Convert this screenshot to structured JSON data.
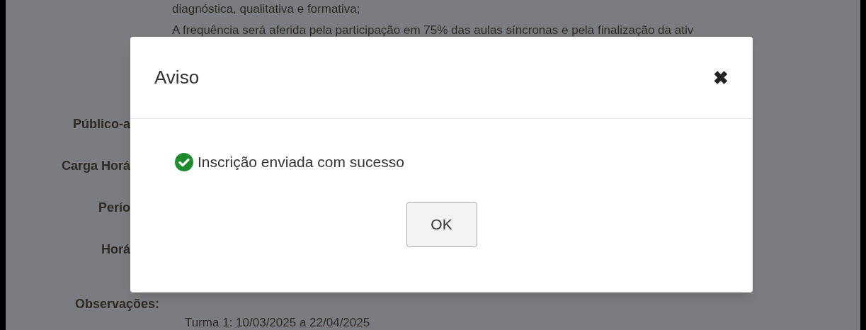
{
  "page": {
    "description_lines": [
      "diagnóstica, qualitativa e formativa;",
      "A frequência será aferida pela participação em 75% das aulas síncronas e pela finalização da ativ"
    ],
    "field_labels": [
      "Público-a",
      "Carga Horá",
      "Perío",
      "Horá"
    ],
    "observations_label": "Observações:",
    "bottom_value": "Turma 1: 10/03/2025 a 22/04/2025"
  },
  "dialog": {
    "title": "Aviso",
    "close": "✖",
    "message": "Inscrição enviada com sucesso",
    "success": true,
    "button": "OK"
  }
}
